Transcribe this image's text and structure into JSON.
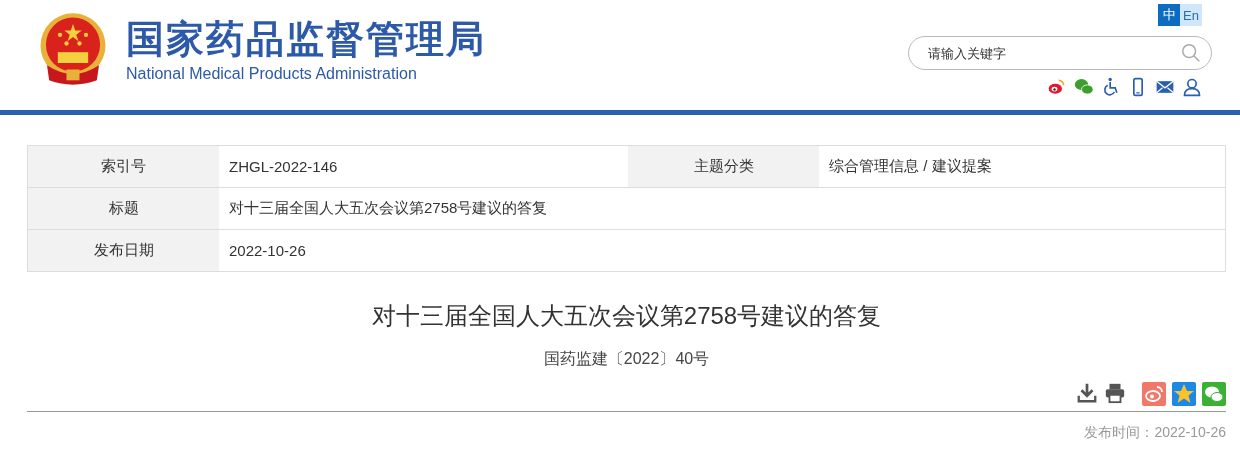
{
  "header": {
    "title_cn": "国家药品监督管理局",
    "title_en": "National Medical Products Administration",
    "languages": [
      {
        "label": "中",
        "selected": true
      },
      {
        "label": "En",
        "selected": false
      }
    ],
    "search": {
      "placeholder": "请输入关键字"
    },
    "social": [
      {
        "kind": "weibo"
      },
      {
        "kind": "wechat"
      },
      {
        "kind": "accessibility"
      },
      {
        "kind": "mobile"
      },
      {
        "kind": "mail"
      },
      {
        "kind": "user"
      }
    ]
  },
  "info_table": {
    "rows": [
      [
        {
          "label": "索引号",
          "value": "ZHGL-2022-146"
        },
        {
          "label": "主题分类",
          "value": "综合管理信息 / 建议提案"
        }
      ],
      [
        {
          "label": "标题",
          "value": "对十三届全国人大五次会议第2758号建议的答复"
        }
      ],
      [
        {
          "label": "发布日期",
          "value": "2022-10-26"
        }
      ]
    ]
  },
  "article": {
    "title": "对十三届全国人大五次会议第2758号建议的答复",
    "doc_number": "国药监建〔2022〕40号",
    "tools": [
      {
        "kind": "download"
      },
      {
        "kind": "print"
      }
    ],
    "share": [
      {
        "kind": "weibo"
      },
      {
        "kind": "qzone"
      },
      {
        "kind": "wechat"
      }
    ],
    "publish_time": "发布时间：2022-10-26"
  }
}
